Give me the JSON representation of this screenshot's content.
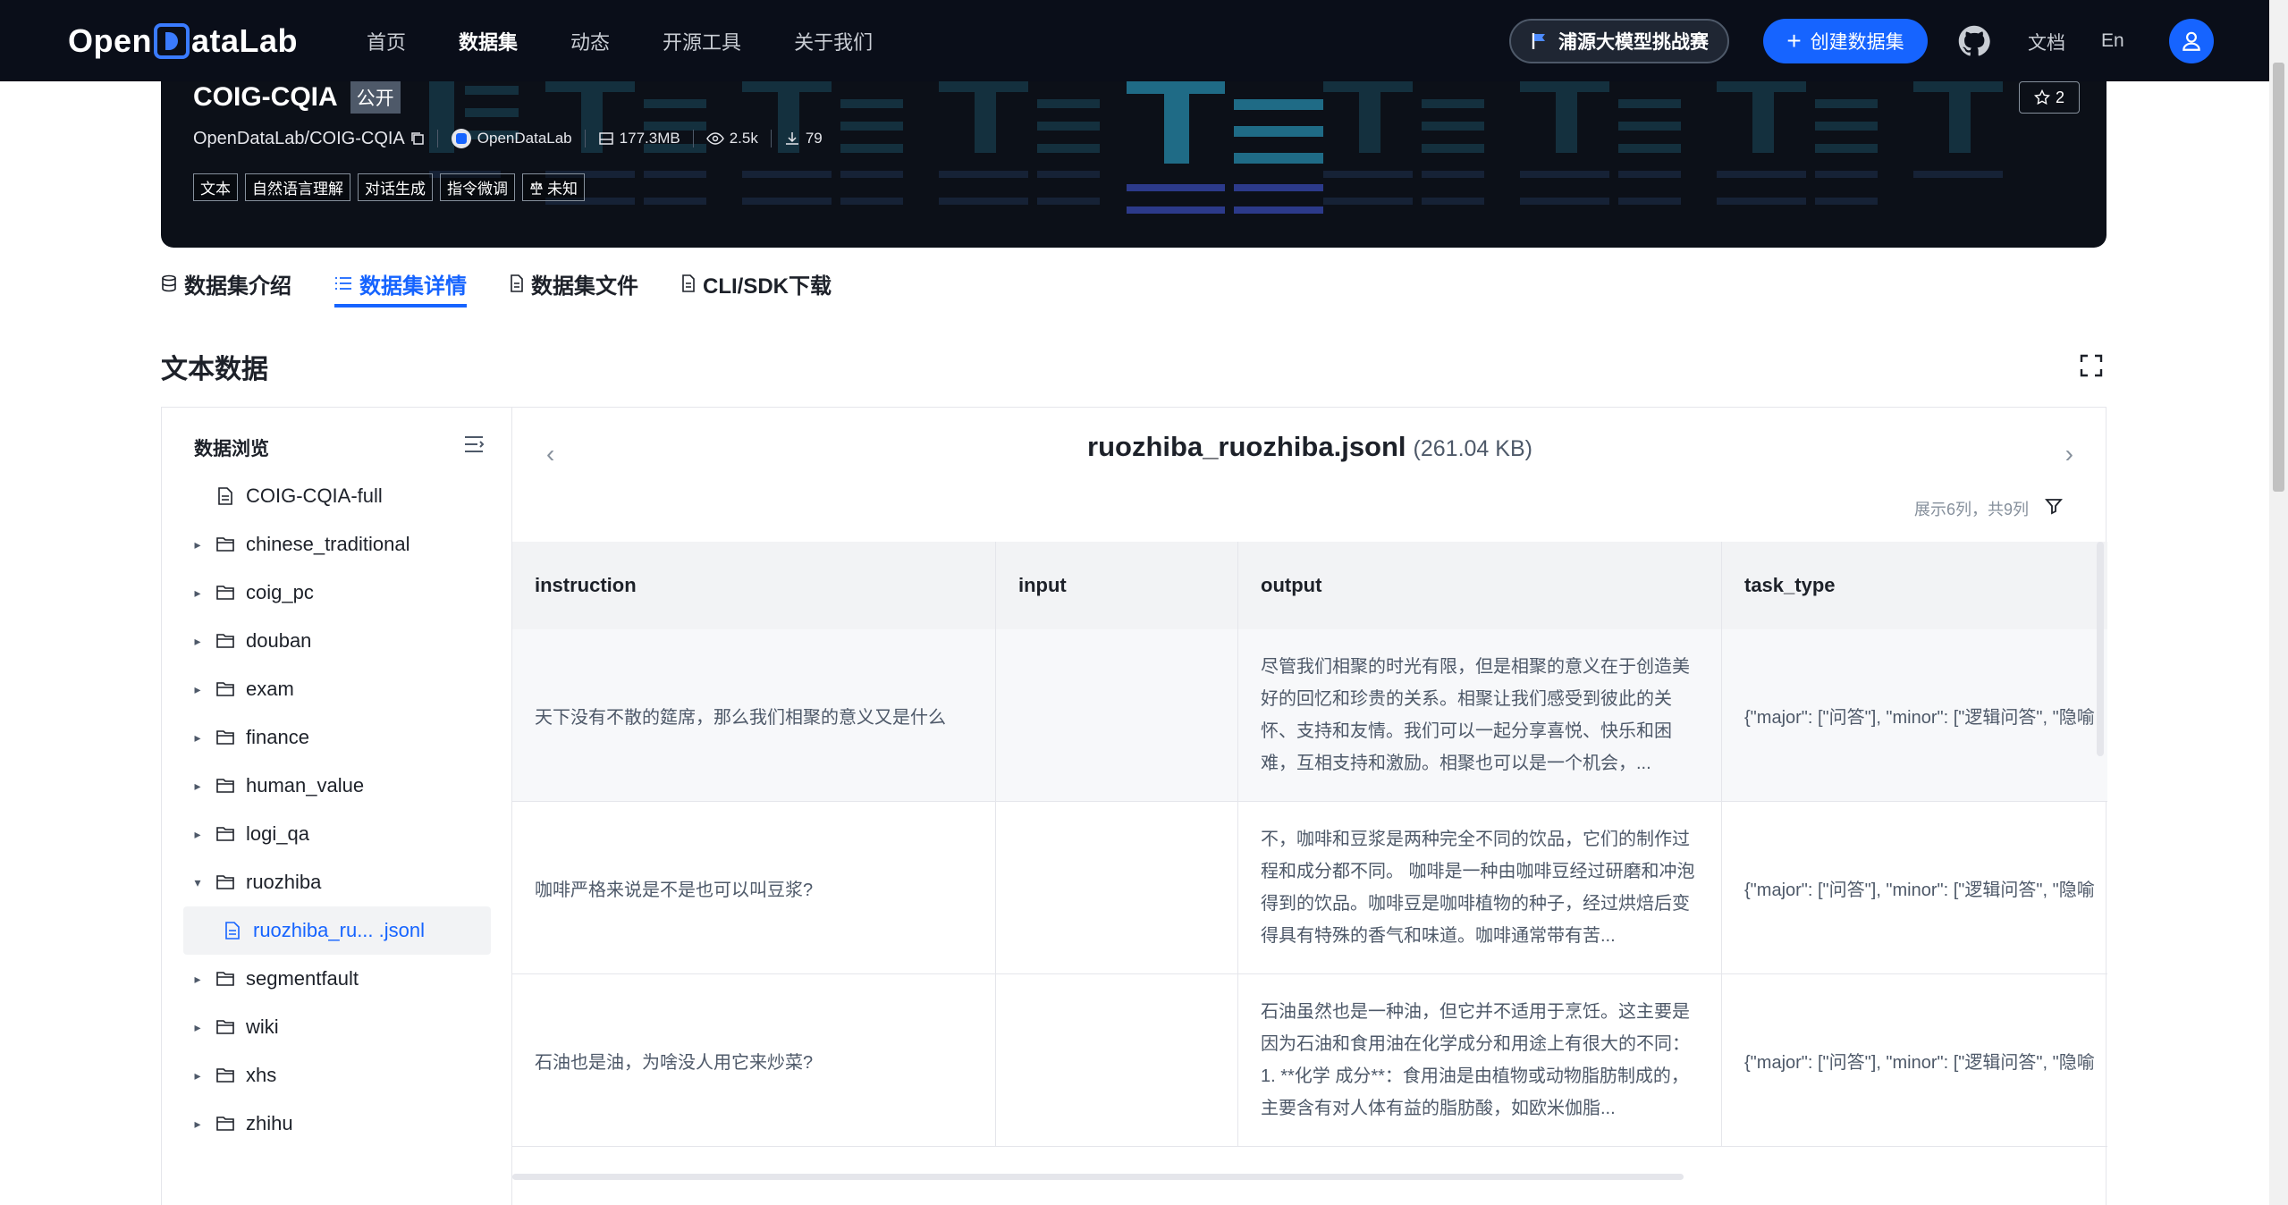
{
  "nav": {
    "logo_left": "Open",
    "logo_right": "ataLab",
    "items": [
      {
        "label": "首页",
        "active": false
      },
      {
        "label": "数据集",
        "active": true
      },
      {
        "label": "动态",
        "active": false
      },
      {
        "label": "开源工具",
        "active": false
      },
      {
        "label": "关于我们",
        "active": false
      }
    ],
    "challenge_label": "浦源大模型挑战赛",
    "create_label": "创建数据集",
    "doc_label": "文档",
    "lang_label": "En",
    "accent": "#1664ff"
  },
  "hero": {
    "name": "COIG-CQIA",
    "visibility": "公开",
    "repo": "OpenDataLab/COIG-CQIA",
    "org": "OpenDataLab",
    "size": "177.3MB",
    "views": "2.5k",
    "downloads": "79",
    "tags": [
      "文本",
      "自然语言理解",
      "对话生成",
      "指令微调",
      "未知"
    ],
    "stars": "2"
  },
  "tabs": [
    {
      "label": "数据集介绍",
      "icon": "database-icon",
      "active": false
    },
    {
      "label": "数据集详情",
      "icon": "list-icon",
      "active": true
    },
    {
      "label": "数据集文件",
      "icon": "file-icon",
      "active": false
    },
    {
      "label": "CLI/SDK下载",
      "icon": "file-icon",
      "active": false
    }
  ],
  "section_title": "文本数据",
  "sidebar": {
    "title": "数据浏览",
    "items": [
      {
        "label": "COIG-CQIA-full",
        "type": "file",
        "caret": false
      },
      {
        "label": "chinese_traditional",
        "type": "folder",
        "caret": true
      },
      {
        "label": "coig_pc",
        "type": "folder",
        "caret": true
      },
      {
        "label": "douban",
        "type": "folder",
        "caret": true
      },
      {
        "label": "exam",
        "type": "folder",
        "caret": true
      },
      {
        "label": "finance",
        "type": "folder",
        "caret": true
      },
      {
        "label": "human_value",
        "type": "folder",
        "caret": true
      },
      {
        "label": "logi_qa",
        "type": "folder",
        "caret": true
      },
      {
        "label": "ruozhiba",
        "type": "folder",
        "caret": true,
        "expanded": true
      },
      {
        "label": "ruozhiba_ru... .jsonl",
        "type": "file",
        "child": true,
        "selected": true
      },
      {
        "label": "segmentfault",
        "type": "folder",
        "caret": true
      },
      {
        "label": "wiki",
        "type": "folder",
        "caret": true
      },
      {
        "label": "xhs",
        "type": "folder",
        "caret": true
      },
      {
        "label": "zhihu",
        "type": "folder",
        "caret": true
      }
    ]
  },
  "file": {
    "name": "ruozhiba_ruozhiba.jsonl",
    "size": "(261.04 KB)",
    "col_info": "展示6列，共9列"
  },
  "table": {
    "columns": [
      "instruction",
      "input",
      "output",
      "task_type"
    ],
    "rows": [
      {
        "instruction": "天下没有不散的筵席，那么我们相聚的意义又是什么",
        "input": "",
        "output": "尽管我们相聚的时光有限，但是相聚的意义在于创造美好的回忆和珍贵的关系。相聚让我们感受到彼此的关怀、支持和友情。我们可以一起分享喜悦、快乐和困难，互相支持和激励。相聚也可以是一个机会，...",
        "task_type": "{\"major\": [\"问答\"], \"minor\": [\"逻辑问答\", \"隐喻"
      },
      {
        "instruction": "咖啡严格来说是不是也可以叫豆浆?",
        "input": "",
        "output": "不，咖啡和豆浆是两种完全不同的饮品，它们的制作过程和成分都不同。 咖啡是一种由咖啡豆经过研磨和冲泡得到的饮品。咖啡豆是咖啡植物的种子，经过烘焙后变得具有特殊的香气和味道。咖啡通常带有苦...",
        "task_type": "{\"major\": [\"问答\"], \"minor\": [\"逻辑问答\", \"隐喻"
      },
      {
        "instruction": "石油也是油，为啥没人用它来炒菜?",
        "input": "",
        "output": "石油虽然也是一种油，但它并不适用于烹饪。这主要是因为石油和食用油在化学成分和用途上有很大的不同： 1. **化学 成分**：食用油是由植物或动物脂肪制成的，主要含有对人体有益的脂肪酸，如欧米伽脂...",
        "task_type": "{\"major\": [\"问答\"], \"minor\": [\"逻辑问答\", \"隐喻"
      }
    ]
  }
}
